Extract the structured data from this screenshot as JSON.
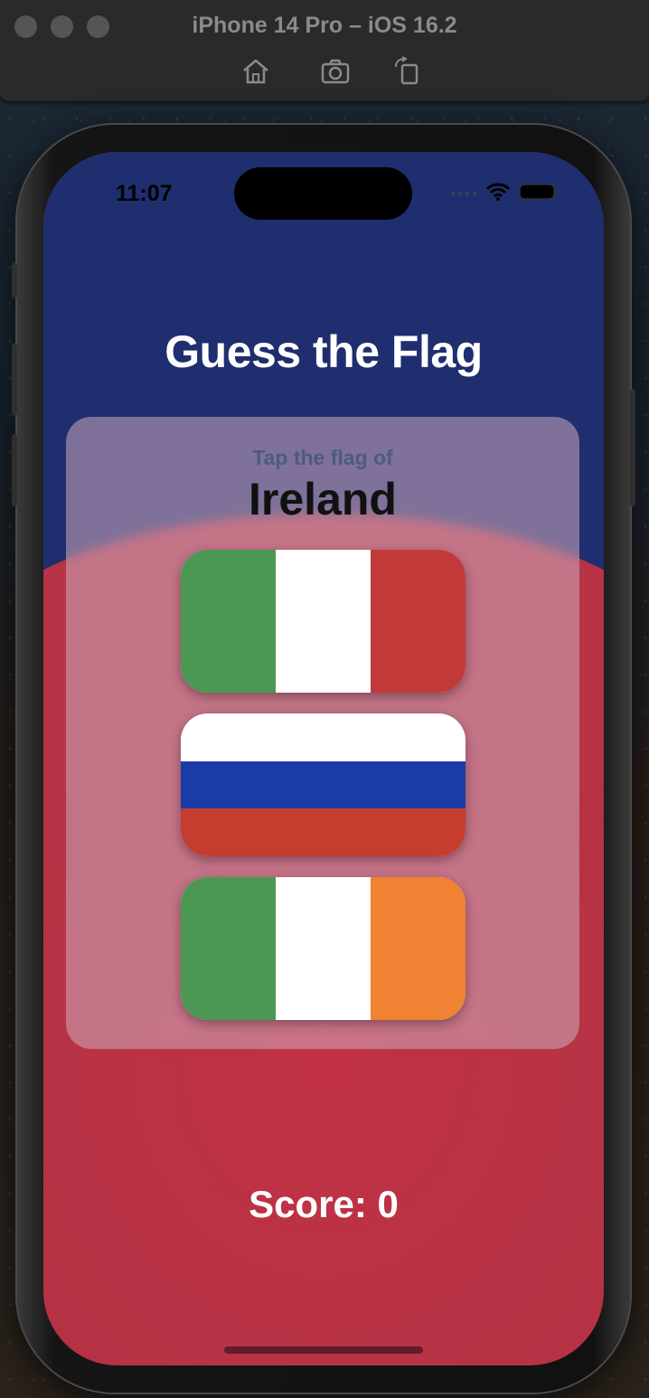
{
  "simulator": {
    "title": "iPhone 14 Pro – iOS 16.2",
    "tools": [
      "home-icon",
      "screenshot-icon",
      "rotate-icon"
    ]
  },
  "status_bar": {
    "time": "11:07",
    "icons": [
      "cellular-icon",
      "wifi-icon",
      "battery-icon"
    ]
  },
  "app": {
    "title": "Guess the Flag",
    "prompt": "Tap the flag of",
    "country": "Ireland",
    "score_label": "Score: 0",
    "flags": [
      {
        "name": "Italy",
        "orientation": "vertical",
        "colors": [
          "#4a9853",
          "#ffffff",
          "#c2393a"
        ]
      },
      {
        "name": "Russia",
        "orientation": "horizontal",
        "colors": [
          "#ffffff",
          "#1b3ca8",
          "#c53d2e"
        ]
      },
      {
        "name": "Ireland",
        "orientation": "vertical",
        "colors": [
          "#4a9853",
          "#ffffff",
          "#ef8233"
        ]
      }
    ]
  },
  "colors": {
    "top_background": "#1f2e6e",
    "bottom_background": "#b73345"
  }
}
